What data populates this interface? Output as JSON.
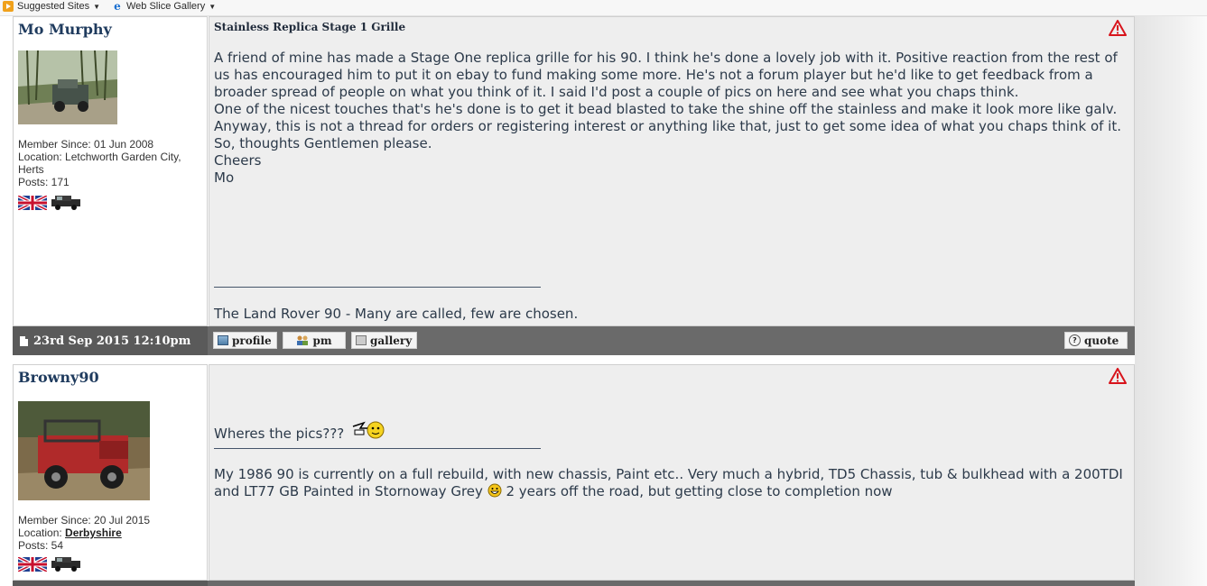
{
  "favorites_bar": {
    "items": [
      {
        "label": "Suggested Sites",
        "icon": "suggested-sites-icon"
      },
      {
        "label": "Web Slice Gallery",
        "icon": "ie-icon"
      }
    ]
  },
  "posts": [
    {
      "username": "Mo Murphy",
      "member_since": "Member Since: 01 Jun 2008",
      "location_prefix": "Location: ",
      "location": "Letchworth Garden City, Herts",
      "posts": "Posts: 171",
      "title": "Stainless Replica Stage 1 Grille",
      "body": [
        "A friend of mine has made a Stage One replica grille for his 90. I think he's done a lovely job with it. Positive reaction from the rest of us has encouraged him to put it on ebay to fund making some more. He's not a forum player but he'd like to get feedback from a broader spread of people on what you think of it. I said I'd post a couple of pics on here and see what you chaps think.",
        "One of the nicest touches that's he's done is to get it bead blasted to take the shine off the stainless and make it look more like galv.",
        "Anyway, this is not a thread for orders or registering interest or anything like that, just to get some idea of what you chaps think of it.",
        "So, thoughts Gentlemen please.",
        "Cheers",
        "Mo"
      ],
      "signature": "The Land Rover 90 - Many are called, few are chosen.",
      "date": "23rd Sep 2015 12:10pm",
      "buttons": {
        "profile": "profile",
        "pm": "pm",
        "gallery": "gallery",
        "quote": "quote"
      }
    },
    {
      "username": "Browny90",
      "member_since": "Member Since: 20 Jul 2015",
      "location_prefix": "Location: ",
      "location": "Derbyshire",
      "posts": "Posts: 54",
      "body_first": "Wheres the pics???",
      "signature_a": "My 1986 90 is currently on a full rebuild, with new chassis, Paint etc.. Very much a hybrid, TD5 Chassis, tub & bulkhead with a 200TDI and LT77 GB Painted in Stornoway Grey",
      "signature_b": " 2 years off the road, but getting close to completion now"
    }
  ],
  "colors": {
    "username": "#1f3b5e",
    "footer": "#6a6a6a",
    "message_bg": "#eeeeee",
    "warning": "#d8141c"
  }
}
